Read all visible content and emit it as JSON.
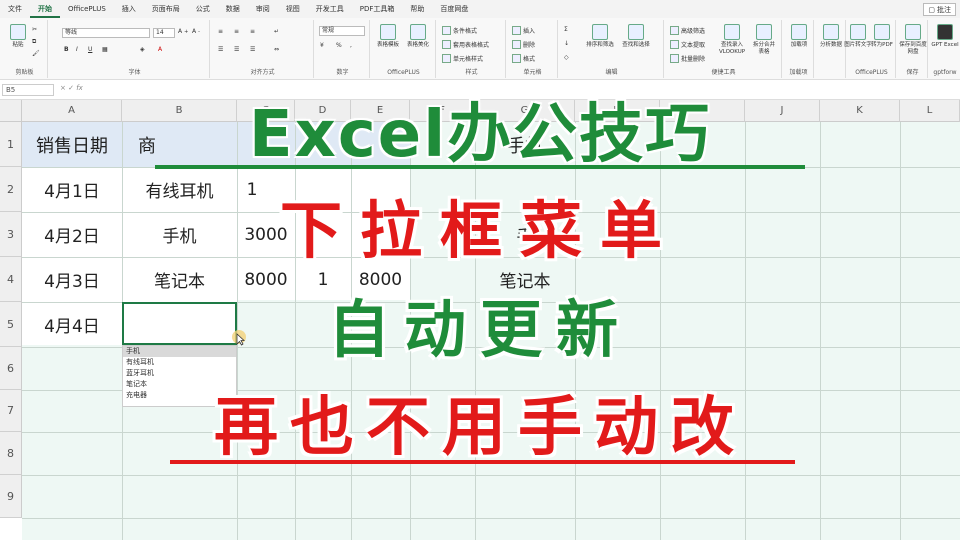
{
  "tabs": [
    "文件",
    "开始",
    "OfficePLUS",
    "插入",
    "页面布局",
    "公式",
    "数据",
    "审阅",
    "视图",
    "开发工具",
    "PDF工具箱",
    "帮助",
    "百度网盘"
  ],
  "active_tab": "开始",
  "share_label": "批注",
  "ribbon": {
    "clipboard": {
      "paste": "粘贴",
      "label": "剪贴板"
    },
    "font": {
      "name": "等线",
      "size": "14",
      "label": "字体"
    },
    "alignment": {
      "label": "对齐方式"
    },
    "number": {
      "format": "常规",
      "label": "数字"
    },
    "officeplus": {
      "btn1": "表格模板",
      "btn2": "表格美化",
      "label": "OfficePLUS"
    },
    "styles": {
      "item1": "条件格式",
      "item2": "套用表格格式",
      "item3": "单元格样式",
      "label": "样式"
    },
    "cells": {
      "item1": "插入",
      "item2": "删除",
      "item3": "格式",
      "label": "单元格"
    },
    "editing": {
      "btn1": "排序和筛选",
      "btn2": "查找和选择",
      "label": "编辑"
    },
    "tools": {
      "item1": "高级筛选",
      "item2": "文本提取",
      "item3": "批量删除",
      "btn1": "查找录入 VLOOKUP",
      "btn2": "拆分合并 表格",
      "label": "便捷工具"
    },
    "addins": {
      "btn": "加载项",
      "label": "加载项"
    },
    "analysis": {
      "btn": "分析数据",
      "label": ""
    },
    "officeplus2": {
      "btn1": "图片转文字",
      "btn2": "转为PDF",
      "label": "OfficePLUS"
    },
    "save": {
      "btn": "保存到百度网盘",
      "label": "保存"
    },
    "gpt": {
      "btn": "GPT Excel",
      "label": "gptforw"
    }
  },
  "namebox": "B5",
  "fx": "fx",
  "columns": [
    "A",
    "B",
    "C",
    "D",
    "E",
    "F",
    "G",
    "H",
    "I",
    "J",
    "K",
    "L"
  ],
  "rows": [
    "1",
    "2",
    "3",
    "4",
    "5",
    "6",
    "7",
    "8",
    "9"
  ],
  "table": {
    "header": {
      "a": "销售日期",
      "b": "商",
      "g": "手机"
    },
    "rows": [
      {
        "a": "4月1日",
        "b": "有线耳机",
        "c": "1"
      },
      {
        "a": "4月2日",
        "b": "手机",
        "c": "3000",
        "g": "手"
      },
      {
        "a": "4月3日",
        "b": "笔记本",
        "c": "8000",
        "d": "1",
        "e": "8000",
        "g": "笔记本"
      },
      {
        "a": "4月4日"
      }
    ]
  },
  "dropdown": [
    "手机",
    "有线耳机",
    "蓝牙耳机",
    "笔记本",
    "充电器"
  ],
  "banners": {
    "line1": "Excel办公技巧",
    "line2": "下拉框菜单",
    "line3": "自动更新",
    "line4": "再也不用手动改"
  },
  "colors": {
    "green": "#1f8c3a",
    "red": "#e21a1a",
    "excel_green": "#217346"
  }
}
